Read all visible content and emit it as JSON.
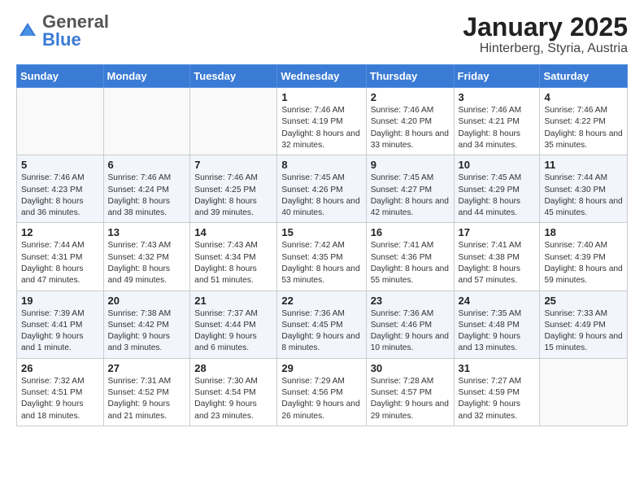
{
  "header": {
    "logo_general": "General",
    "logo_blue": "Blue",
    "title": "January 2025",
    "location": "Hinterberg, Styria, Austria"
  },
  "days_of_week": [
    "Sunday",
    "Monday",
    "Tuesday",
    "Wednesday",
    "Thursday",
    "Friday",
    "Saturday"
  ],
  "weeks": [
    [
      {
        "day": "",
        "info": ""
      },
      {
        "day": "",
        "info": ""
      },
      {
        "day": "",
        "info": ""
      },
      {
        "day": "1",
        "info": "Sunrise: 7:46 AM\nSunset: 4:19 PM\nDaylight: 8 hours and 32 minutes."
      },
      {
        "day": "2",
        "info": "Sunrise: 7:46 AM\nSunset: 4:20 PM\nDaylight: 8 hours and 33 minutes."
      },
      {
        "day": "3",
        "info": "Sunrise: 7:46 AM\nSunset: 4:21 PM\nDaylight: 8 hours and 34 minutes."
      },
      {
        "day": "4",
        "info": "Sunrise: 7:46 AM\nSunset: 4:22 PM\nDaylight: 8 hours and 35 minutes."
      }
    ],
    [
      {
        "day": "5",
        "info": "Sunrise: 7:46 AM\nSunset: 4:23 PM\nDaylight: 8 hours and 36 minutes."
      },
      {
        "day": "6",
        "info": "Sunrise: 7:46 AM\nSunset: 4:24 PM\nDaylight: 8 hours and 38 minutes."
      },
      {
        "day": "7",
        "info": "Sunrise: 7:46 AM\nSunset: 4:25 PM\nDaylight: 8 hours and 39 minutes."
      },
      {
        "day": "8",
        "info": "Sunrise: 7:45 AM\nSunset: 4:26 PM\nDaylight: 8 hours and 40 minutes."
      },
      {
        "day": "9",
        "info": "Sunrise: 7:45 AM\nSunset: 4:27 PM\nDaylight: 8 hours and 42 minutes."
      },
      {
        "day": "10",
        "info": "Sunrise: 7:45 AM\nSunset: 4:29 PM\nDaylight: 8 hours and 44 minutes."
      },
      {
        "day": "11",
        "info": "Sunrise: 7:44 AM\nSunset: 4:30 PM\nDaylight: 8 hours and 45 minutes."
      }
    ],
    [
      {
        "day": "12",
        "info": "Sunrise: 7:44 AM\nSunset: 4:31 PM\nDaylight: 8 hours and 47 minutes."
      },
      {
        "day": "13",
        "info": "Sunrise: 7:43 AM\nSunset: 4:32 PM\nDaylight: 8 hours and 49 minutes."
      },
      {
        "day": "14",
        "info": "Sunrise: 7:43 AM\nSunset: 4:34 PM\nDaylight: 8 hours and 51 minutes."
      },
      {
        "day": "15",
        "info": "Sunrise: 7:42 AM\nSunset: 4:35 PM\nDaylight: 8 hours and 53 minutes."
      },
      {
        "day": "16",
        "info": "Sunrise: 7:41 AM\nSunset: 4:36 PM\nDaylight: 8 hours and 55 minutes."
      },
      {
        "day": "17",
        "info": "Sunrise: 7:41 AM\nSunset: 4:38 PM\nDaylight: 8 hours and 57 minutes."
      },
      {
        "day": "18",
        "info": "Sunrise: 7:40 AM\nSunset: 4:39 PM\nDaylight: 8 hours and 59 minutes."
      }
    ],
    [
      {
        "day": "19",
        "info": "Sunrise: 7:39 AM\nSunset: 4:41 PM\nDaylight: 9 hours and 1 minute."
      },
      {
        "day": "20",
        "info": "Sunrise: 7:38 AM\nSunset: 4:42 PM\nDaylight: 9 hours and 3 minutes."
      },
      {
        "day": "21",
        "info": "Sunrise: 7:37 AM\nSunset: 4:44 PM\nDaylight: 9 hours and 6 minutes."
      },
      {
        "day": "22",
        "info": "Sunrise: 7:36 AM\nSunset: 4:45 PM\nDaylight: 9 hours and 8 minutes."
      },
      {
        "day": "23",
        "info": "Sunrise: 7:36 AM\nSunset: 4:46 PM\nDaylight: 9 hours and 10 minutes."
      },
      {
        "day": "24",
        "info": "Sunrise: 7:35 AM\nSunset: 4:48 PM\nDaylight: 9 hours and 13 minutes."
      },
      {
        "day": "25",
        "info": "Sunrise: 7:33 AM\nSunset: 4:49 PM\nDaylight: 9 hours and 15 minutes."
      }
    ],
    [
      {
        "day": "26",
        "info": "Sunrise: 7:32 AM\nSunset: 4:51 PM\nDaylight: 9 hours and 18 minutes."
      },
      {
        "day": "27",
        "info": "Sunrise: 7:31 AM\nSunset: 4:52 PM\nDaylight: 9 hours and 21 minutes."
      },
      {
        "day": "28",
        "info": "Sunrise: 7:30 AM\nSunset: 4:54 PM\nDaylight: 9 hours and 23 minutes."
      },
      {
        "day": "29",
        "info": "Sunrise: 7:29 AM\nSunset: 4:56 PM\nDaylight: 9 hours and 26 minutes."
      },
      {
        "day": "30",
        "info": "Sunrise: 7:28 AM\nSunset: 4:57 PM\nDaylight: 9 hours and 29 minutes."
      },
      {
        "day": "31",
        "info": "Sunrise: 7:27 AM\nSunset: 4:59 PM\nDaylight: 9 hours and 32 minutes."
      },
      {
        "day": "",
        "info": ""
      }
    ]
  ]
}
